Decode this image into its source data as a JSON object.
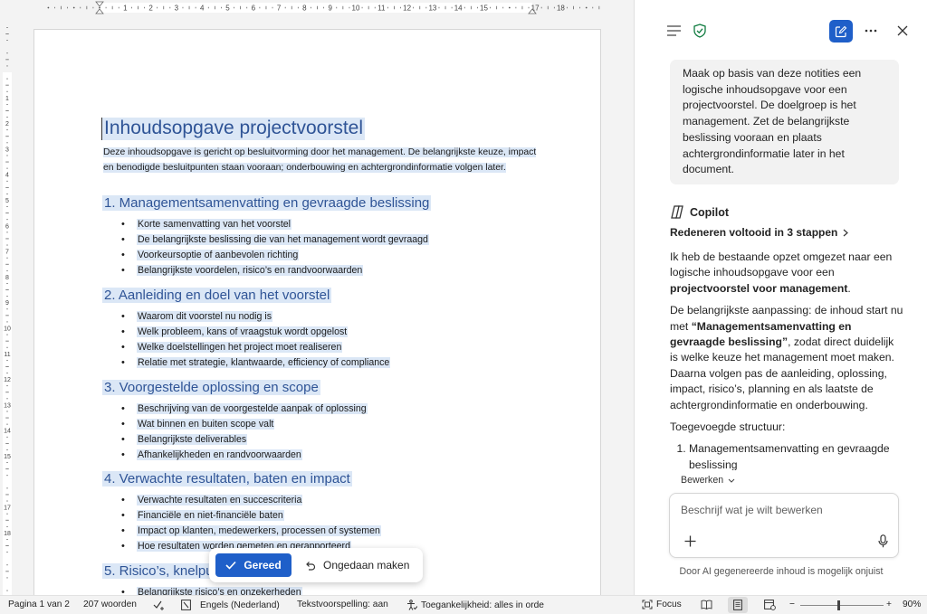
{
  "document": {
    "title": "Inhoudsopgave projectvoorstel",
    "intro": "Deze inhoudsopgave is gericht op besluitvorming door het management. De belangrijkste keuze, impact en benodigde besluitpunten staan vooraan; onderbouwing en achtergrondinformatie volgen later.",
    "sections": [
      {
        "heading": "1. Managementsamenvatting en gevraagde beslissing",
        "items": [
          "Korte samenvatting van het voorstel",
          "De belangrijkste beslissing die van het management wordt gevraagd",
          "Voorkeursoptie of aanbevolen richting",
          "Belangrijkste voordelen, risico’s en randvoorwaarden"
        ]
      },
      {
        "heading": "2. Aanleiding en doel van het voorstel",
        "items": [
          "Waarom dit voorstel nu nodig is",
          "Welk probleem, kans of vraagstuk wordt opgelost",
          "Welke doelstellingen het project moet realiseren",
          "Relatie met strategie, klantwaarde, efficiency of compliance"
        ]
      },
      {
        "heading": "3. Voorgestelde oplossing en scope",
        "items": [
          "Beschrijving van de voorgestelde aanpak of oplossing",
          "Wat binnen en buiten scope valt",
          "Belangrijkste deliverables",
          "Afhankelijkheden en randvoorwaarden"
        ]
      },
      {
        "heading": "4. Verwachte resultaten, baten en impact",
        "items": [
          "Verwachte resultaten en succescriteria",
          "Financiële en niet-financiële baten",
          "Impact op klanten, medewerkers, processen of systemen",
          "Hoe resultaten worden gemeten en gerapporteerd"
        ]
      },
      {
        "heading": "5. Risico’s, knelpunten",
        "items": [
          "Belangrijkste risico’s en onzekerheden"
        ]
      }
    ]
  },
  "action_bar": {
    "done_label": "Gereed",
    "undo_label": "Ongedaan maken"
  },
  "copilot": {
    "user_message": "Maak op basis van deze notities een logische inhoudsopgave voor een projectvoorstel. De doelgroep is het management. Zet de belangrijkste beslissing vooraan en plaats achtergrondinformatie later in het document.",
    "assistant_name": "Copilot",
    "reasoning_label": "Redeneren voltooid in 3 stappen",
    "response": {
      "p1_start": "Ik heb de bestaande opzet omgezet naar een logische inhoudsopgave voor een ",
      "p1_bold": "projectvoorstel voor management",
      "p1_end": ".",
      "p2_start": "De belangrijkste aanpassing: de inhoud start nu met ",
      "p2_bold": "“Managementsamenvatting en gevraagde beslissing”",
      "p2_end": ", zodat direct duidelijk is welke keuze het management moet maken. Daarna volgen pas de aanleiding, oplossing, impact, risico’s, planning en als laatste de achtergrondinformatie en onderbouwing.",
      "p3": "Toegevoegde structuur:",
      "list": [
        "Managementsamenvatting en gevraagde beslissing"
      ]
    },
    "edit_mode_label": "Bewerken",
    "input_placeholder": "Beschrijf wat je wilt bewerken",
    "disclaimer": "Door AI gegenereerde inhoud is mogelijk onjuist"
  },
  "statusbar": {
    "page": "Pagina 1 van 2",
    "words": "207 woorden",
    "language": "Engels (Nederland)",
    "prediction": "Tekstvoorspelling: aan",
    "accessibility": "Toegankelijkheid: alles in orde",
    "focus": "Focus",
    "zoom_minus": "−",
    "zoom_plus": "+",
    "zoom": "90%"
  },
  "ruler": {
    "numbers": [
      "1",
      "2",
      "3",
      "4",
      "5",
      "6",
      "7",
      "8",
      "9",
      "10",
      "11",
      "12",
      "13",
      "14",
      "15",
      "",
      "17",
      "18"
    ]
  },
  "colors": {
    "accent": "#1f5fc9",
    "heading": "#2f5496",
    "highlight": "#dbe7f6"
  }
}
